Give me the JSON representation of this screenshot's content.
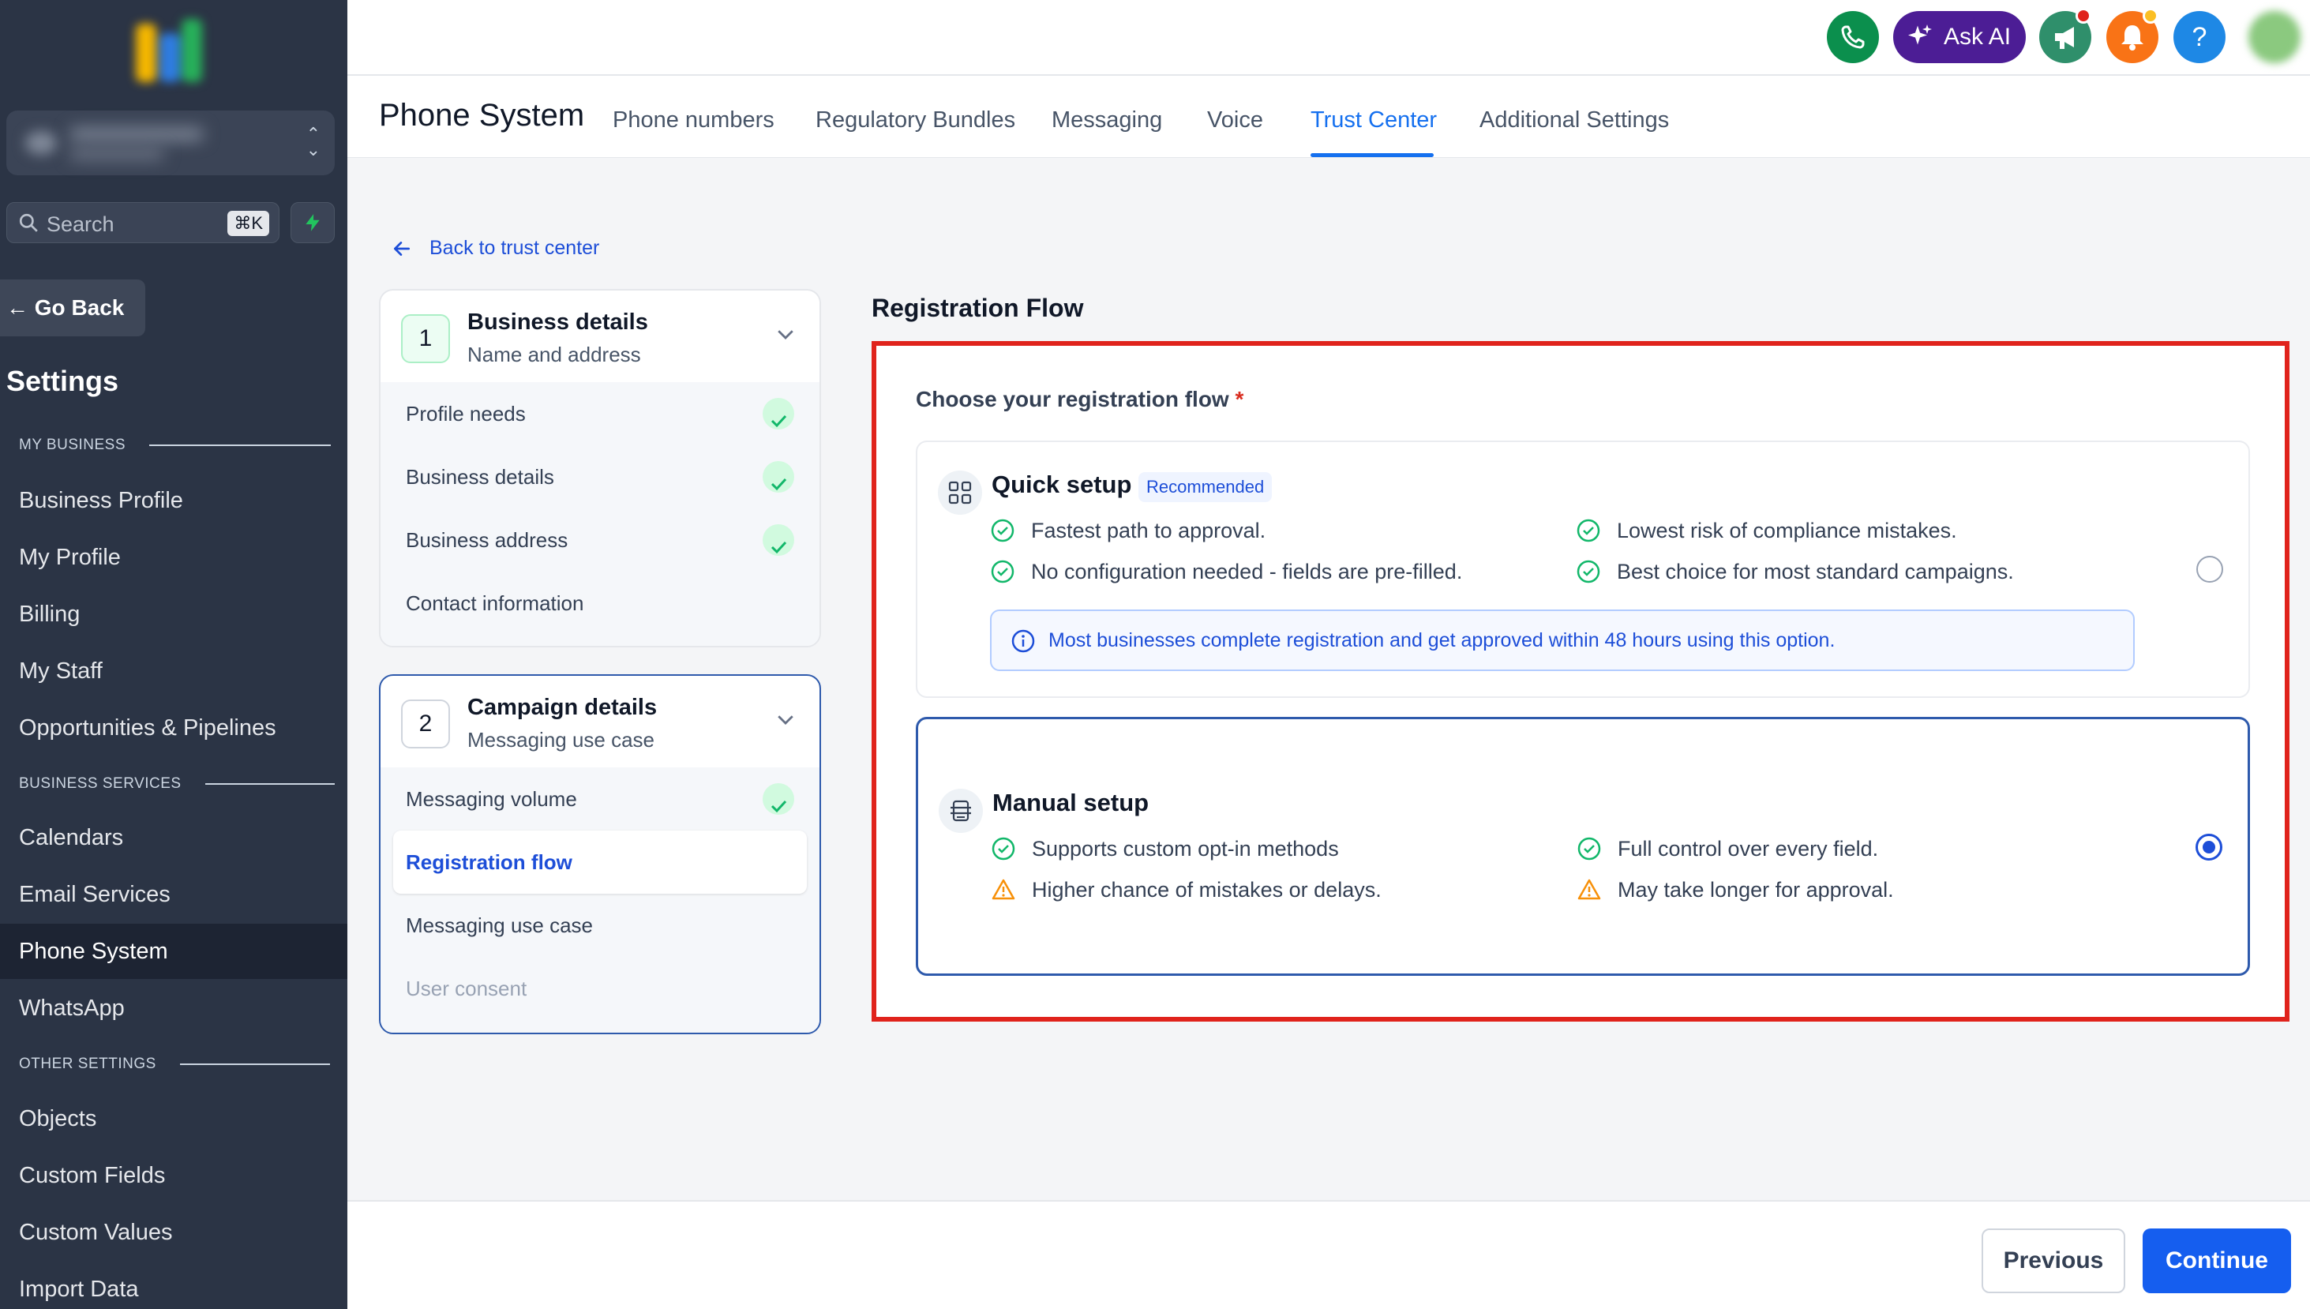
{
  "sidebar": {
    "search_placeholder": "Search",
    "search_shortcut": "⌘K",
    "go_back": "Go Back",
    "settings_title": "Settings",
    "sections": {
      "my_business": "MY BUSINESS",
      "business_services": "BUSINESS SERVICES",
      "other_settings": "OTHER SETTINGS"
    },
    "items": [
      "Business Profile",
      "My Profile",
      "Billing",
      "My Staff",
      "Opportunities & Pipelines",
      "Calendars",
      "Email Services",
      "Phone System",
      "WhatsApp",
      "Objects",
      "Custom Fields",
      "Custom Values",
      "Import Data"
    ],
    "active_item": "Phone System"
  },
  "topbar": {
    "ask_ai": "Ask AI",
    "help": "?",
    "colors": {
      "phone": "#0b8f4d",
      "ask_ai": "#4c1d95",
      "megaphone": "#2f8f6b",
      "bell": "#f97316",
      "help": "#1e88e5"
    }
  },
  "header": {
    "page_title": "Phone System",
    "tabs": [
      "Phone numbers",
      "Regulatory Bundles",
      "Messaging",
      "Voice",
      "Trust Center",
      "Additional Settings"
    ],
    "active_tab": "Trust Center"
  },
  "back_link": "Back to trust center",
  "steps": [
    {
      "number": "1",
      "title": "Business details",
      "subtitle": "Name and address",
      "items": [
        {
          "label": "Profile needs",
          "done": true
        },
        {
          "label": "Business details",
          "done": true
        },
        {
          "label": "Business address",
          "done": true
        },
        {
          "label": "Contact information",
          "done": false
        }
      ]
    },
    {
      "number": "2",
      "title": "Campaign details",
      "subtitle": "Messaging use case",
      "items": [
        {
          "label": "Messaging volume",
          "done": true
        },
        {
          "label": "Registration flow",
          "selected": true
        },
        {
          "label": "Messaging use case",
          "done": false
        },
        {
          "label": "User consent",
          "disabled": true
        }
      ]
    }
  ],
  "registration": {
    "title": "Registration Flow",
    "label": "Choose your registration flow",
    "required_mark": "*",
    "options": [
      {
        "name": "Quick setup",
        "badge": "Recommended",
        "features_left": [
          "Fastest path to approval.",
          "No configuration needed - fields are pre-filled."
        ],
        "features_right": [
          "Lowest risk of compliance mistakes.",
          "Best choice for most standard campaigns."
        ],
        "info": "Most businesses complete registration and get approved within 48 hours using this option.",
        "selected": false
      },
      {
        "name": "Manual setup",
        "features_left": [
          "Supports custom opt-in methods",
          "Higher chance of mistakes or delays."
        ],
        "features_right": [
          "Full control over every field.",
          "May take longer for approval."
        ],
        "selected": true
      }
    ]
  },
  "footer": {
    "previous": "Previous",
    "continue": "Continue"
  }
}
